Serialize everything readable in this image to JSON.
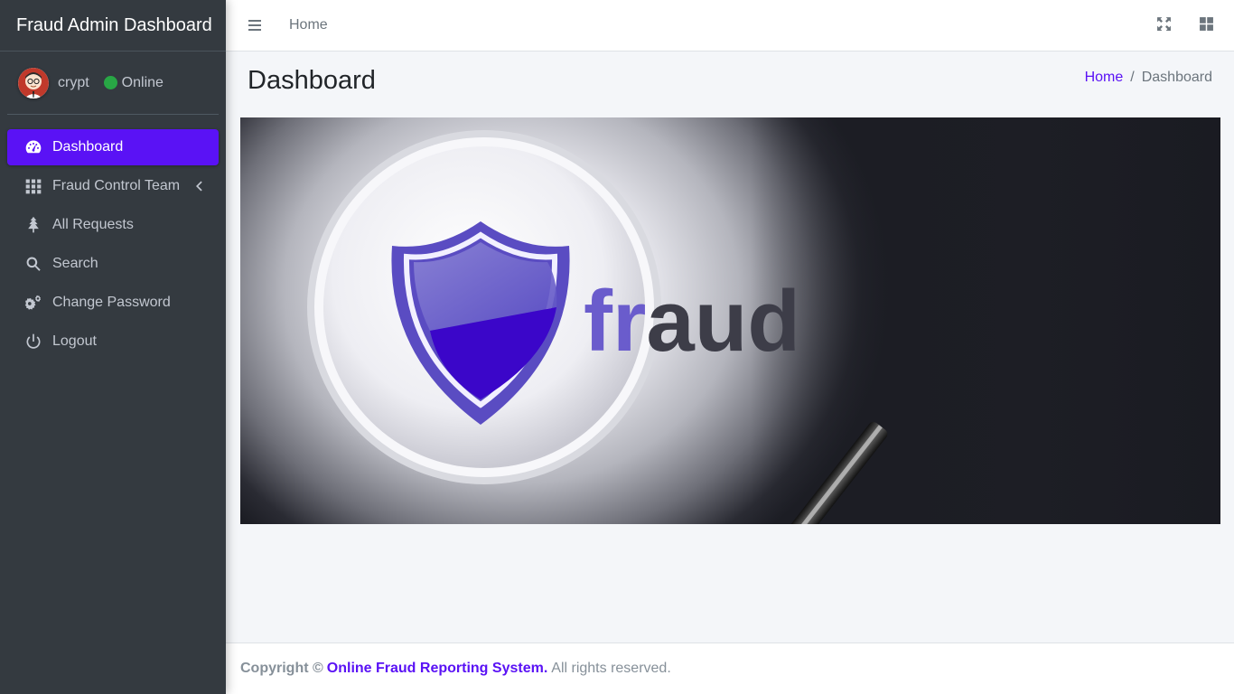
{
  "brand": {
    "title": "Fraud Admin Dashboard"
  },
  "user": {
    "name": "crypt",
    "status": "Online"
  },
  "sidebar": {
    "items": [
      {
        "label": "Dashboard",
        "icon": "tachometer-icon",
        "active": true
      },
      {
        "label": "Fraud Control Team",
        "icon": "grid-icon",
        "has_submenu": true
      },
      {
        "label": "All Requests",
        "icon": "tree-icon"
      },
      {
        "label": "Search",
        "icon": "search-icon"
      },
      {
        "label": "Change Password",
        "icon": "cogs-icon"
      },
      {
        "label": "Logout",
        "icon": "power-icon"
      }
    ]
  },
  "topbar": {
    "home_label": "Home"
  },
  "page": {
    "title": "Dashboard"
  },
  "breadcrumb": {
    "home": "Home",
    "separator": "/",
    "current": "Dashboard"
  },
  "hero": {
    "text": "fraud"
  },
  "footer": {
    "copyright": "Copyright ©",
    "site": "Online Fraud Reporting System.",
    "rights": "All rights reserved."
  },
  "colors": {
    "accent": "#5a12f5",
    "sidebar_bg": "#343a40",
    "online": "#28a745"
  }
}
